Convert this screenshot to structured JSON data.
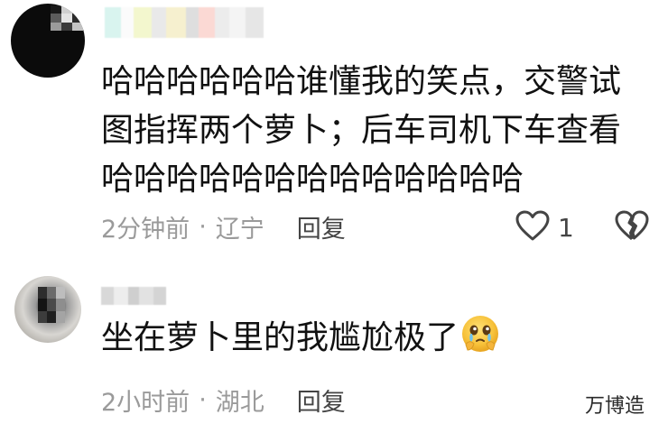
{
  "comments": [
    {
      "text_lines": [
        "哈哈哈哈哈哈谁懂我的笑点，交警试",
        "图指挥两个萝卜；后车司机下车查看",
        "哈哈哈哈哈哈哈哈哈哈哈哈哈"
      ],
      "time": "2分钟前",
      "separator": "·",
      "location": "辽宁",
      "reply_label": "回复",
      "likes": "1",
      "icons": {
        "like": "heart-outline-icon",
        "dislike": "broken-heart-icon"
      }
    },
    {
      "text_lines": [
        "坐在萝卜里的我尴尬极了"
      ],
      "emoji": "crying-face-emoji",
      "time": "2小时前",
      "separator": "·",
      "location": "湖北",
      "reply_label": "回复"
    }
  ],
  "watermark": "万博造",
  "colors": {
    "text": "#111111",
    "meta": "#9a9a9a",
    "action": "#444444",
    "background": "#ffffff"
  }
}
